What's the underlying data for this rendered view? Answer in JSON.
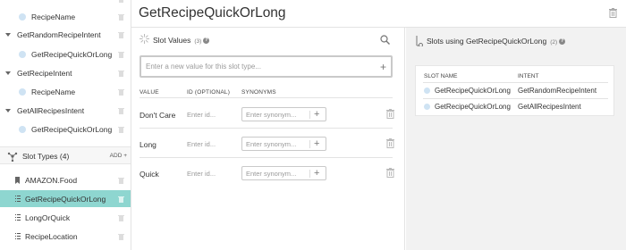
{
  "sidebar": {
    "intents": [
      {
        "kind": "slot",
        "label": "RecipeName"
      },
      {
        "kind": "intent",
        "label": "GetRandomRecipeIntent"
      },
      {
        "kind": "slot",
        "label": "GetRecipeQuickOrLong"
      },
      {
        "kind": "intent",
        "label": "GetRecipeIntent"
      },
      {
        "kind": "slot",
        "label": "RecipeName"
      },
      {
        "kind": "intent",
        "label": "GetAllRecipesIntent"
      },
      {
        "kind": "slot",
        "label": "GetRecipeQuickOrLong"
      }
    ],
    "slot_types_header": "Slot Types (4)",
    "add_label": "ADD +",
    "slot_types": [
      {
        "label": "AMAZON.Food",
        "icon": "bookmark-icon",
        "selected": false
      },
      {
        "label": "GetRecipeQuickOrLong",
        "icon": "list-icon",
        "selected": true
      },
      {
        "label": "LongOrQuick",
        "icon": "list-icon",
        "selected": false
      },
      {
        "label": "RecipeLocation",
        "icon": "list-icon",
        "selected": false
      }
    ]
  },
  "main": {
    "title": "GetRecipeQuickOrLong",
    "slot_values": {
      "title": "Slot Values",
      "count": "(3)",
      "new_value_placeholder": "Enter a new value for this slot type...",
      "columns": {
        "value": "VALUE",
        "id": "ID (OPTIONAL)",
        "synonyms": "SYNONYMS"
      },
      "id_placeholder": "Enter id...",
      "synonym_placeholder": "Enter synonym...",
      "rows": [
        {
          "value": "Don't Care"
        },
        {
          "value": "Long"
        },
        {
          "value": "Quick"
        }
      ]
    },
    "slots_using": {
      "title": "Slots using GetRecipeQuickOrLong",
      "count": "(2)",
      "columns": {
        "slot_name": "SLOT NAME",
        "intent": "INTENT"
      },
      "rows": [
        {
          "slot_name": "GetRecipeQuickOrLong",
          "intent": "GetRandomRecipeIntent"
        },
        {
          "slot_name": "GetRecipeQuickOrLong",
          "intent": "GetAllRecipesIntent"
        }
      ]
    }
  },
  "colors": {
    "selected_bg": "#8ed6d0",
    "slot_dot": "#cfe3f3",
    "right_panel_bg": "#f2f2f2"
  }
}
